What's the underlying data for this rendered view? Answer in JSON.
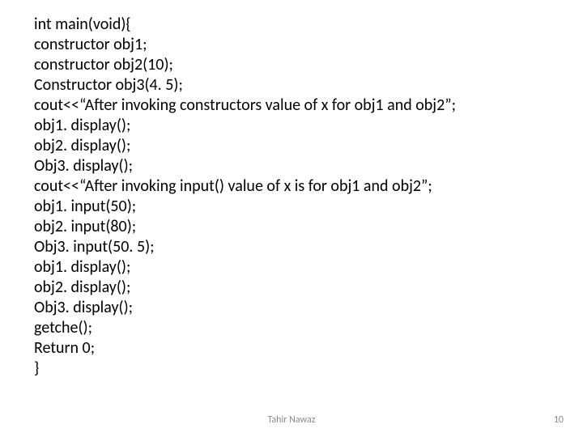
{
  "code": {
    "lines": [
      "int main(void){",
      "constructor obj1;",
      "constructor obj2(10);",
      "Constructor obj3(4. 5);",
      "cout<<“After invoking constructors value of x for obj1 and obj2”;",
      "obj1. display();",
      "obj2. display();",
      "Obj3. display();",
      "cout<<“After invoking input() value of x is for obj1 and obj2”;",
      "obj1. input(50);",
      "obj2. input(80);",
      "Obj3. input(50. 5);",
      "obj1. display();",
      "obj2. display();",
      "Obj3. display();",
      "getche();",
      "Return 0;",
      "}"
    ]
  },
  "footer": {
    "author": "Tahir Nawaz",
    "page": "10"
  }
}
